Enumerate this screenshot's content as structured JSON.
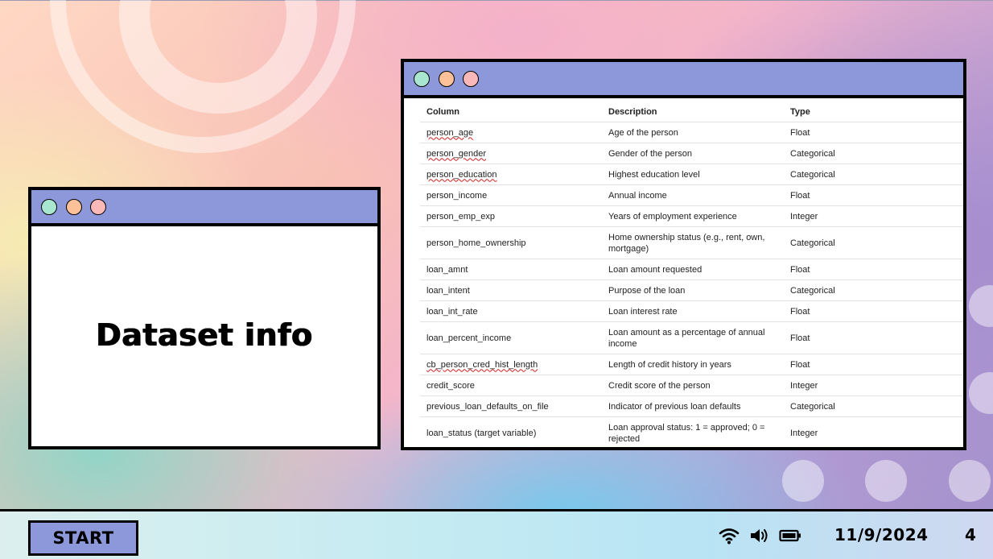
{
  "slide": {
    "title": "Dataset info",
    "page_number": "4"
  },
  "table": {
    "headers": [
      "Column",
      "Description",
      "Type"
    ],
    "rows": [
      {
        "column": "person_age",
        "description": "Age of the person",
        "type": "Float"
      },
      {
        "column": "person_gender",
        "description": "Gender of the person",
        "type": "Categorical"
      },
      {
        "column": "person_education",
        "description": "Highest education level",
        "type": "Categorical"
      },
      {
        "column": "person_income",
        "description": "Annual income",
        "type": "Float"
      },
      {
        "column": "person_emp_exp",
        "description": "Years of employment experience",
        "type": "Integer"
      },
      {
        "column": "person_home_ownership",
        "description": "Home ownership status (e.g., rent, own, mortgage)",
        "type": "Categorical"
      },
      {
        "column": "loan_amnt",
        "description": "Loan amount requested",
        "type": "Float"
      },
      {
        "column": "loan_intent",
        "description": "Purpose of the loan",
        "type": "Categorical"
      },
      {
        "column": "loan_int_rate",
        "description": "Loan interest rate",
        "type": "Float"
      },
      {
        "column": "loan_percent_income",
        "description": "Loan amount as a percentage of annual income",
        "type": "Float"
      },
      {
        "column": "cb_person_cred_hist_length",
        "description": "Length of credit history in years",
        "type": "Float"
      },
      {
        "column": "credit_score",
        "description": "Credit score of the person",
        "type": "Integer"
      },
      {
        "column": "previous_loan_defaults_on_file",
        "description": "Indicator of previous loan defaults",
        "type": "Categorical"
      },
      {
        "column": "loan_status (target variable)",
        "description": "Loan approval status: 1 = approved; 0 = rejected",
        "type": "Integer"
      }
    ]
  },
  "taskbar": {
    "start_label": "START",
    "date": "11/9/2024",
    "icons": [
      "wifi-icon",
      "volume-icon",
      "battery-icon"
    ]
  },
  "colors": {
    "titlebar": "#8c98da",
    "btn_green": "#a8e6cf",
    "btn_orange": "#fdc19a",
    "btn_pink": "#fbb8b8"
  }
}
